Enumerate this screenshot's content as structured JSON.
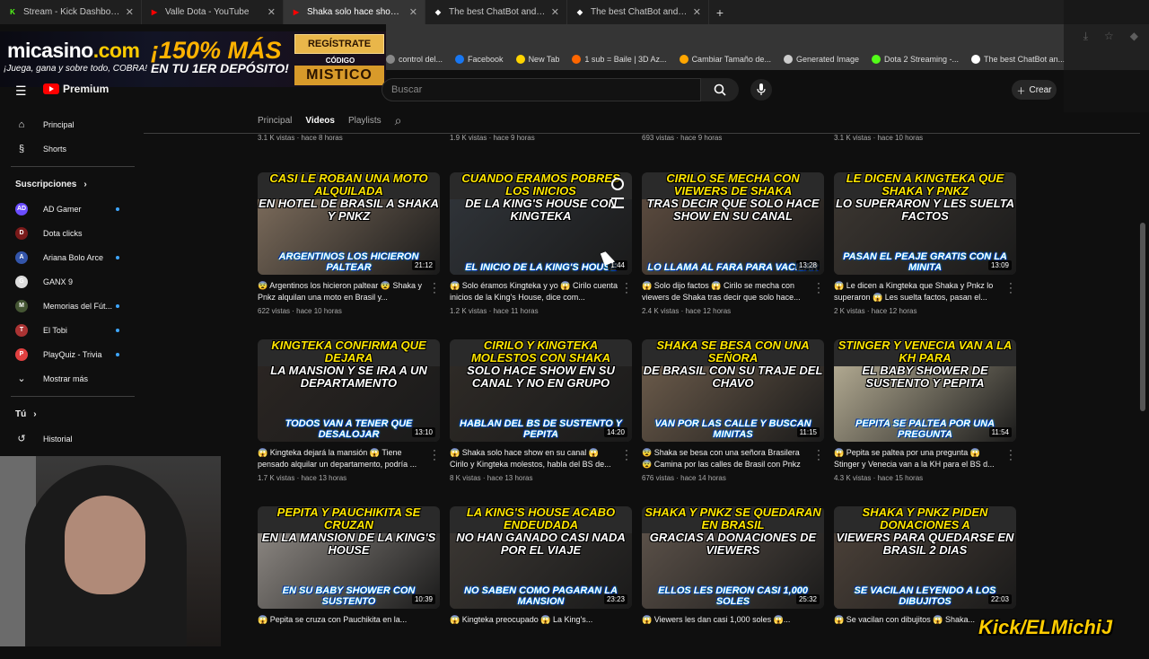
{
  "browser": {
    "tabs": [
      {
        "label": "Stream - Kick Dashboard",
        "fav": "K",
        "favColor": "#53fc18",
        "active": false
      },
      {
        "label": "Valle Dota - YouTube",
        "fav": "▶",
        "favColor": "#ff0000",
        "active": false
      },
      {
        "label": "Shaka solo hace show en su",
        "fav": "▶",
        "favColor": "#ff0000",
        "active": true
      },
      {
        "label": "The best ChatBot and Widgets",
        "fav": "◆",
        "favColor": "#ffffff",
        "active": false
      },
      {
        "label": "The best ChatBot and Widgets",
        "fav": "◆",
        "favColor": "#ffffff",
        "active": false
      }
    ],
    "new_tab": "+",
    "bookmarks": [
      {
        "label": "control del...",
        "color": "#888888"
      },
      {
        "label": "Facebook",
        "color": "#1877f2"
      },
      {
        "label": "New Tab",
        "color": "#ffd400"
      },
      {
        "label": "1 sub = Baile | 3D Az...",
        "color": "#ff6600"
      },
      {
        "label": "Cambiar Tamaño de...",
        "color": "#ffa600"
      },
      {
        "label": "Generated Image",
        "color": "#cccccc"
      },
      {
        "label": "Dota 2 Streaming -...",
        "color": "#53fc18"
      },
      {
        "label": "The best ChatBot an...",
        "color": "#ffffff"
      }
    ]
  },
  "ad": {
    "logo": "micasino",
    "logo_tld": ".com",
    "tagline": "¡Juega, gana y sobre todo, COBRA!",
    "promo": "¡150% MÁS",
    "promo2": "EN TU 1ER DEPÓSITO!",
    "register": "REGÍSTRATE",
    "code_label": "CÓDIGO",
    "code": "MISTICO"
  },
  "yt": {
    "logo": "Premium",
    "search_placeholder": "Buscar",
    "create": "Crear"
  },
  "sidebar": {
    "main": [
      {
        "label": "Principal",
        "icon": "⌂"
      },
      {
        "label": "Shorts",
        "icon": "§"
      }
    ],
    "subs_heading": "Suscripciones",
    "subs": [
      {
        "label": "AD Gamer",
        "color": "#6a4cff",
        "initial": "AD",
        "live": true
      },
      {
        "label": "Dota clicks",
        "color": "#7a1a1a",
        "initial": "D",
        "live": false
      },
      {
        "label": "Ariana Bolo Arce",
        "color": "#3355aa",
        "initial": "A",
        "live": true
      },
      {
        "label": "GANX 9",
        "color": "#dddddd",
        "initial": "G",
        "live": false
      },
      {
        "label": "Memorias del Fút...",
        "color": "#445533",
        "initial": "M",
        "live": true
      },
      {
        "label": "El Tobi",
        "color": "#aa3333",
        "initial": "T",
        "live": true
      },
      {
        "label": "PlayQuiz - Trivia",
        "color": "#e04040",
        "initial": "P",
        "live": true
      },
      {
        "label": "Mostrar más",
        "color": "",
        "initial": "⌄",
        "live": false
      }
    ],
    "you_heading": "Tú",
    "you": [
      {
        "label": "Historial",
        "icon": "↺"
      }
    ]
  },
  "channel_tabs": [
    "Principal",
    "Videos",
    "Playlists"
  ],
  "prev_row_meta": [
    "3.1 K vistas · hace 8 horas",
    "1.9 K vistas · hace 9 horas",
    "693 vistas · hace 9 horas",
    "3.1 K vistas · hace 10 horas"
  ],
  "videos": [
    {
      "thumb_top": "CASI LE ROBAN UNA MOTO ALQUILADA",
      "thumb_top2": "EN HOTEL DE BRASIL A SHAKA Y PNKZ",
      "thumb_bottom": "ARGENTINOS LOS HICIERON PALTEAR",
      "duration": "21:12",
      "title": "😨 Argentinos los hicieron paltear 😨 Shaka y Pnkz alquilan una moto en Brasil y...",
      "meta": "622 vistas · hace 10 horas",
      "bg": "#7a6a5a"
    },
    {
      "thumb_top": "CUANDO ERAMOS POBRES LOS INICIOS",
      "thumb_top2": "DE LA KING'S HOUSE CON KINGTEKA",
      "thumb_bottom": "EL INICIO DE LA KING'S HOUSE",
      "duration": "1:44",
      "title": "😱 Solo éramos Kingteka y yo 😱 Cirilo cuenta inicios de la King's House, dice com...",
      "meta": "1.2 K vistas · hace 11 horas",
      "bg": "#2f3338"
    },
    {
      "thumb_top": "CIRILO SE MECHA CON VIEWERS DE SHAKA",
      "thumb_top2": "TRAS DECIR QUE SOLO HACE SHOW EN SU CANAL",
      "thumb_bottom": "LO LLAMA AL FARA PARA VACILAR",
      "duration": "13:28",
      "title": "😱 Solo dijo factos 😱 Cirilo se mecha con viewers de Shaka tras decir que solo hace...",
      "meta": "2.4 K vistas · hace 12 horas",
      "bg": "#5a4a3e"
    },
    {
      "thumb_top": "LE DICEN A KINGTEKA QUE SHAKA Y PNKZ",
      "thumb_top2": "LO SUPERARON Y LES SUELTA FACTOS",
      "thumb_bottom": "PASAN EL PEAJE GRATIS CON LA MINITA",
      "duration": "13:09",
      "title": "😱 Le dicen a Kingteka que Shaka y Pnkz lo superaron 😱 Les suelta factos, pasan el...",
      "meta": "2 K vistas · hace 12 horas",
      "bg": "#3a3530"
    },
    {
      "thumb_top": "KINGTEKA CONFIRMA QUE DEJARA",
      "thumb_top2": "LA MANSION Y SE IRA A UN DEPARTAMENTO",
      "thumb_bottom": "TODOS VAN A TENER QUE DESALOJAR",
      "duration": "13:10",
      "title": "😱 Kingteka dejará la mansión 😱 Tiene pensado alquilar un departamento, podría ...",
      "meta": "1.7 K vistas · hace 13 horas",
      "bg": "#2a2522"
    },
    {
      "thumb_top": "CIRILO Y KINGTEKA MOLESTOS CON SHAKA",
      "thumb_top2": "SOLO HACE SHOW EN SU CANAL Y NO EN GRUPO",
      "thumb_bottom": "HABLAN DEL BS DE SUSTENTO Y PEPITA",
      "duration": "14:20",
      "title": "😱 Shaka solo hace show en su canal 😱 Cirilo y Kingteka molestos, habla del BS de...",
      "meta": "8 K vistas · hace 13 horas",
      "bg": "#2e2a26"
    },
    {
      "thumb_top": "SHAKA SE BESA CON UNA SEÑORA",
      "thumb_top2": "DE BRASIL CON SU TRAJE DEL CHAVO",
      "thumb_bottom": "VAN POR LAS CALLE Y BUSCAN MINITAS",
      "duration": "11:15",
      "title": "😨 Shaka se besa con una señora Brasilera 😨 Camina por las calles de Brasil con Pnkz",
      "meta": "676 vistas · hace 14 horas",
      "bg": "#6a5a4a"
    },
    {
      "thumb_top": "STINGER Y VENECIA VAN A LA KH PARA",
      "thumb_top2": "EL BABY SHOWER DE SUSTENTO Y PEPITA",
      "thumb_bottom": "PEPITA SE PALTEA POR UNA PREGUNTA",
      "duration": "11:54",
      "title": "😱 Pepita se paltea por una pregunta 😱 Stinger y Venecia van a la KH para el BS d...",
      "meta": "4.3 K vistas · hace 15 horas",
      "bg": "#b0a890"
    },
    {
      "thumb_top": "PEPITA Y PAUCHIKITA SE CRUZAN",
      "thumb_top2": "EN LA MANSION DE LA KING'S HOUSE",
      "thumb_bottom": "EN SU BABY SHOWER CON SUSTENTO",
      "duration": "10:39",
      "title": "😱 Pepita se cruza con Pauchikita en la...",
      "meta": "",
      "bg": "#8a8580"
    },
    {
      "thumb_top": "LA KING'S HOUSE ACABO ENDEUDADA",
      "thumb_top2": "NO HAN GANADO CASI NADA POR EL VIAJE",
      "thumb_bottom": "NO SABEN COMO PAGARAN LA MANSION",
      "duration": "23:23",
      "title": "😱 Kingteka preocupado 😱 La King's...",
      "meta": "",
      "bg": "#3a3632"
    },
    {
      "thumb_top": "SHAKA Y PNKZ SE QUEDARAN EN BRASIL",
      "thumb_top2": "GRACIAS A DONACIONES DE VIEWERS",
      "thumb_bottom": "ELLOS LES DIERON CASI 1,000 SOLES",
      "duration": "25:32",
      "title": "😱 Viewers les dan casi 1,000 soles 😱...",
      "meta": "",
      "bg": "#5a5048"
    },
    {
      "thumb_top": "SHAKA Y PNKZ PIDEN DONACIONES A",
      "thumb_top2": "VIEWERS PARA QUEDARSE EN BRASIL 2 DIAS",
      "thumb_bottom": "SE VACILAN LEYENDO A LOS DIBUJITOS",
      "duration": "22:03",
      "title": "😱 Se vacilan con dibujitos 😱 Shaka...",
      "meta": "",
      "bg": "#4a4038"
    }
  ],
  "overlay": {
    "brand": "Kick/ELMichiJ"
  }
}
